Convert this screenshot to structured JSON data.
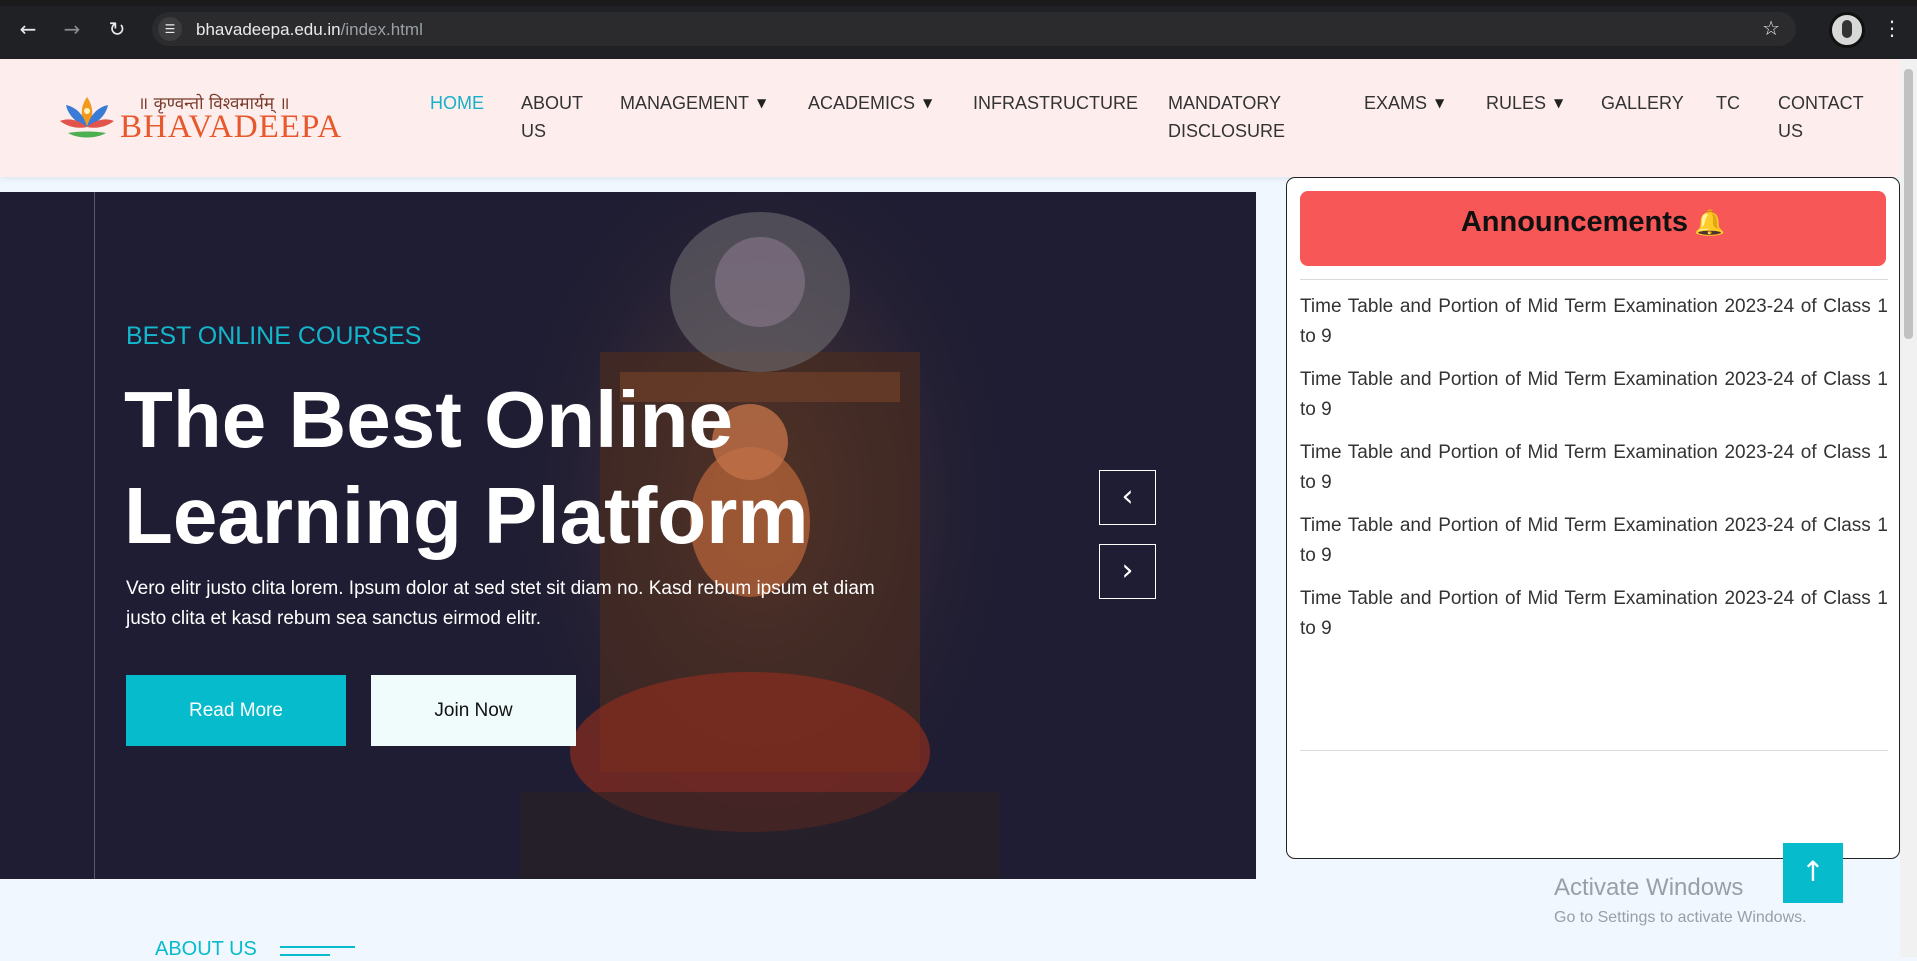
{
  "browser": {
    "url_domain": "bhavadeepa.edu.in",
    "url_path": "/index.html",
    "back_icon": "arrow-left",
    "forward_icon": "arrow-right",
    "reload_icon": "reload",
    "site_info_icon": "tune",
    "bookmark_icon": "star-outline",
    "menu_icon": "vertical-dots"
  },
  "logo": {
    "tagline": "॥ कृण्वन्तो विश्वमार्यम् ॥",
    "name": "BHAVADEEPA"
  },
  "nav": {
    "home": "HOME",
    "about_1": "ABOUT",
    "about_2": "US",
    "management": "MANAGEMENT",
    "academics": "ACADEMICS",
    "infrastructure": "INFRASTRUCTURE",
    "mandatory_1": "MANDATORY",
    "mandatory_2": "DISCLOSURE",
    "exams": "EXAMS",
    "rules": "RULES",
    "gallery": "GALLERY",
    "tc": "TC",
    "contact_1": "CONTACT",
    "contact_2": "US",
    "chevron": "⌄"
  },
  "hero": {
    "eyebrow": "BEST ONLINE COURSES",
    "title": "The Best Online Learning Platform",
    "text": "Vero elitr justo clita lorem. Ipsum dolor at sed stet sit diam no. Kasd rebum ipsum et diam justo clita et kasd rebum sea sanctus eirmod elitr.",
    "read_more": "Read More",
    "join_now": "Join Now",
    "prev": "‹",
    "next": "›"
  },
  "announcements": {
    "title": "Announcements",
    "bell": "🔔",
    "items": [
      "Time Table and Portion of Mid Term Examination 2023-24 of Class 1 to 9",
      "Time Table and Portion of Mid Term Examination 2023-24 of Class 1 to 9",
      "Time Table and Portion of Mid Term Examination 2023-24 of Class 1 to 9",
      "Time Table and Portion of Mid Term Examination 2023-24 of Class 1 to 9",
      "Time Table and Portion of Mid Term Examination 2023-24 of Class 1 to 9"
    ]
  },
  "scroll_top": "↑",
  "watermark": {
    "title": "Activate Windows",
    "subtitle": "Go to Settings to activate Windows."
  },
  "about": {
    "heading": "ABOUT US"
  },
  "colors": {
    "accent": "#06bbcc",
    "header_bg": "#fdeeed",
    "announcement_head": "#f85757",
    "hero_bg": "#1f1d33"
  }
}
